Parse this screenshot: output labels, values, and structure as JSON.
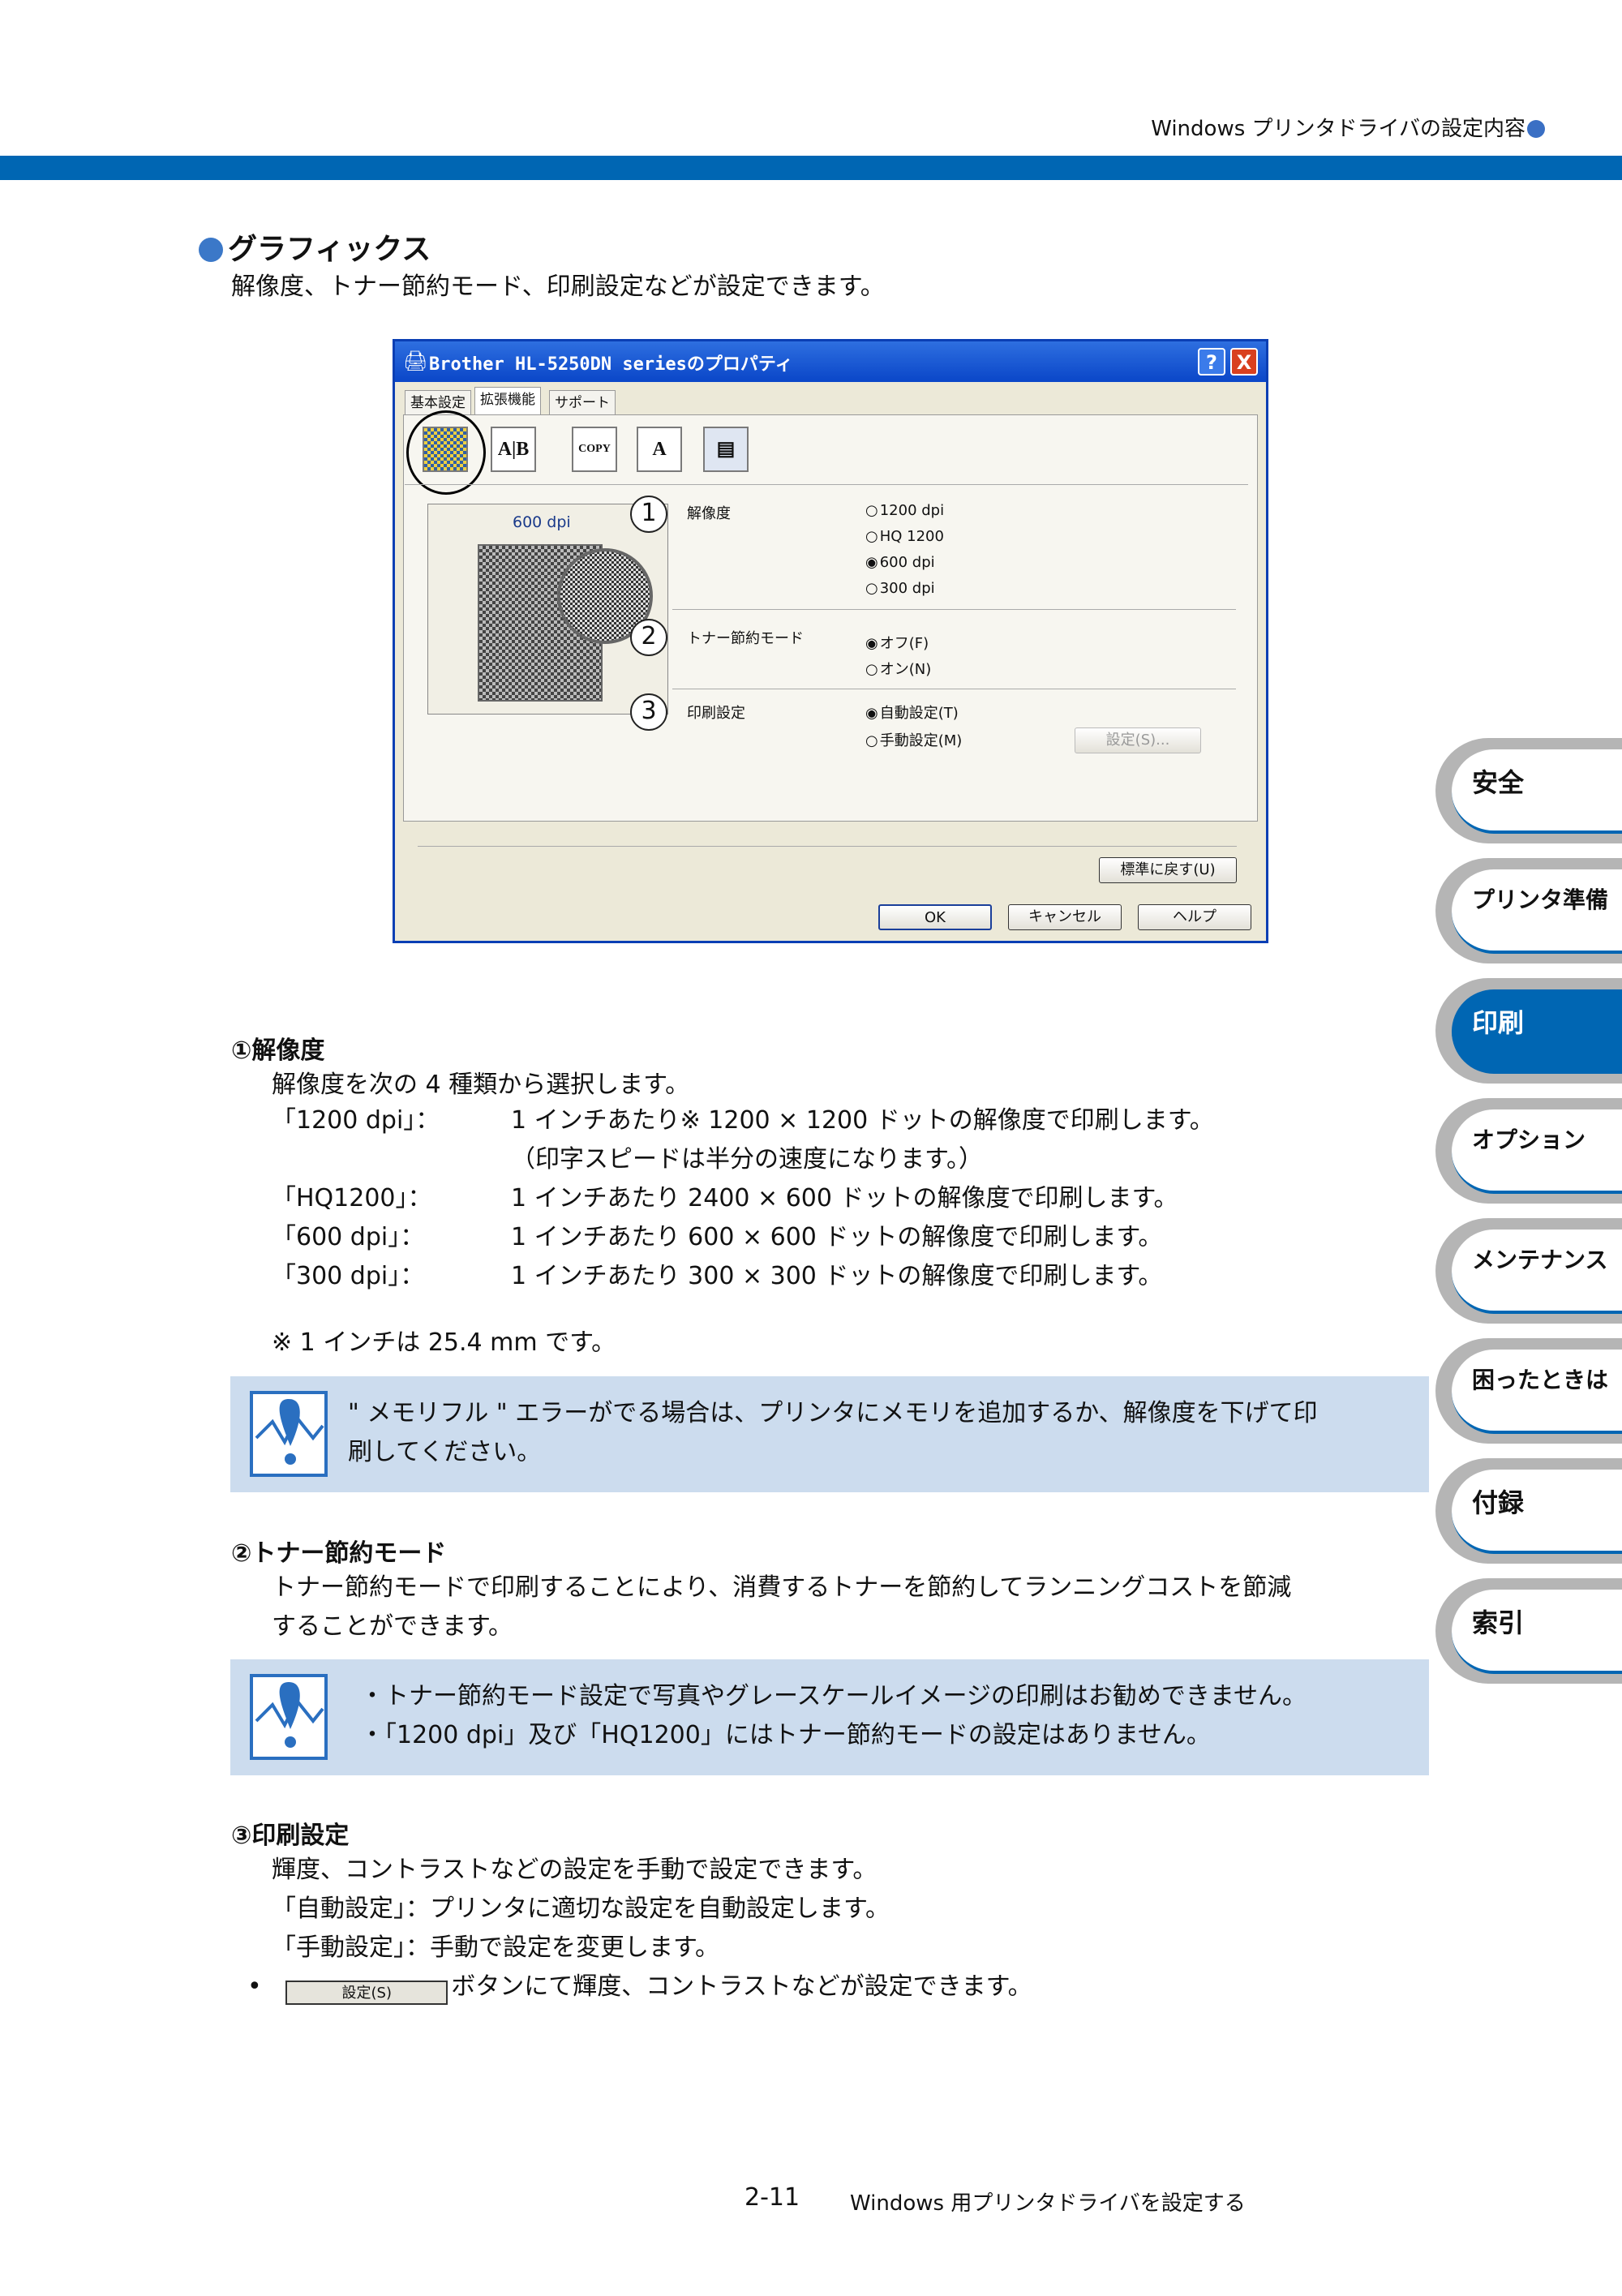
{
  "header": {
    "title": "Windows プリンタドライバの設定内容"
  },
  "section": {
    "title": "グラフィックス",
    "intro": "解像度、トナー節約モード、印刷設定などが設定できます。"
  },
  "dialog": {
    "title": "Brother HL-5250DN seriesのプロパティ",
    "help_btn": "?",
    "close_btn": "X",
    "tabs": [
      "基本設定",
      "拡張機能",
      "サポート"
    ],
    "preview_label": "600 dpi",
    "options": [
      {
        "num": "1",
        "label": "解像度",
        "choices": [
          "1200 dpi",
          "HQ 1200",
          "600 dpi",
          "300 dpi"
        ]
      },
      {
        "num": "2",
        "label": "トナー節約モード",
        "choices": [
          "オフ(F)",
          "オン(N)"
        ]
      },
      {
        "num": "3",
        "label": "印刷設定",
        "choices": [
          "自動設定(T)",
          "手動設定(M)"
        ]
      }
    ],
    "settings_btn": "設定(S)...",
    "default_btn": "標準に戻す(U)",
    "ok_btn": "OK",
    "cancel_btn": "キャンセル",
    "help_text_btn": "ヘルプ"
  },
  "resolution": {
    "heading": "①解像度",
    "intro": "解像度を次の 4 種類から選択します。",
    "rows": [
      {
        "key": "「1200 dpi」：",
        "desc": "1 インチあたり※ 1200 × 1200 ドットの解像度で印刷します。"
      },
      {
        "key": "",
        "desc": "（印字スピードは半分の速度になります。）"
      },
      {
        "key": "「HQ1200」：",
        "desc": "1 インチあたり 2400 × 600 ドットの解像度で印刷します。"
      },
      {
        "key": "「600 dpi」：",
        "desc": "1 インチあたり 600 × 600 ドットの解像度で印刷します。"
      },
      {
        "key": "「300 dpi」：",
        "desc": "1 インチあたり 300 × 300 ドットの解像度で印刷します。"
      }
    ],
    "footnote": "※ 1 インチは 25.4 mm です。",
    "note": [
      "\" メモリフル \" エラーがでる場合は、プリンタにメモリを追加するか、解像度を下げて印",
      "刷してください。"
    ]
  },
  "toner": {
    "heading": "②トナー節約モード",
    "body": [
      "トナー節約モードで印刷することにより、消費するトナーを節約してランニングコストを節減",
      "することができます。"
    ],
    "note": [
      "・トナー節約モード設定で写真やグレースケールイメージの印刷はお勧めできません。",
      "・「1200 dpi」及び「HQ1200」にはトナー節約モードの設定はありません。"
    ]
  },
  "printset": {
    "heading": "③印刷設定",
    "lines": [
      "輝度、コントラストなどの設定を手動で設定できます。",
      "「自動設定」：プリンタに適切な設定を自動設定します。",
      "「手動設定」：手動で設定を変更します。"
    ],
    "bullet": "•",
    "button_label": "設定(S)",
    "bullet_text": "ボタンにて輝度、コントラストなどが設定できます。"
  },
  "side_tabs": [
    "安全",
    "プリンタ準備",
    "印刷",
    "オプション",
    "メンテナンス",
    "困ったときは",
    "付録",
    "索引"
  ],
  "footer": {
    "page": "2-11",
    "title": "Windows 用プリンタドライバを設定する"
  }
}
